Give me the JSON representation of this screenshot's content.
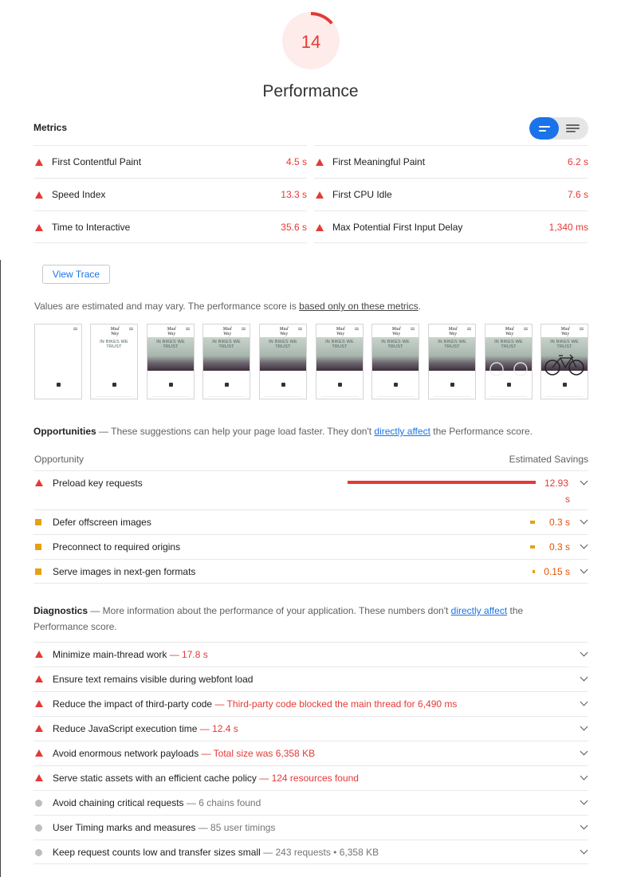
{
  "gauge": {
    "score": "14",
    "title": "Performance",
    "fraction": 0.14,
    "color": "#e53935"
  },
  "metrics": {
    "title": "Metrics",
    "items": [
      {
        "label": "First Contentful Paint",
        "value": "4.5 s"
      },
      {
        "label": "First Meaningful Paint",
        "value": "6.2 s"
      },
      {
        "label": "Speed Index",
        "value": "13.3 s"
      },
      {
        "label": "First CPU Idle",
        "value": "7.6 s"
      },
      {
        "label": "Time to Interactive",
        "value": "35.6 s"
      },
      {
        "label": "Max Potential First Input Delay",
        "value": "1,340 ms"
      }
    ]
  },
  "view_trace": "View Trace",
  "disclaimer": {
    "text": "Values are estimated and may vary. The performance score is ",
    "link": "based only on these metrics",
    "end": "."
  },
  "filmstrip": {
    "hero_text": "IN BIKES WE TRUST",
    "logo_text": "Mad Way"
  },
  "opportunities": {
    "title": "Opportunities",
    "desc": " — These suggestions can help your page load faster. They don't ",
    "link": "directly affect",
    "desc_end": " the Performance score.",
    "col_left": "Opportunity",
    "col_right": "Estimated Savings",
    "items": [
      {
        "label": "Preload key requests",
        "saving_line1": "12.93",
        "saving_line2": "s",
        "level": "fail",
        "bar_fraction": 1.0
      },
      {
        "label": "Defer offscreen images",
        "saving": "0.3 s",
        "level": "average",
        "bar_fraction": 0.02
      },
      {
        "label": "Preconnect to required origins",
        "saving": "0.3 s",
        "level": "average",
        "bar_fraction": 0.02
      },
      {
        "label": "Serve images in next-gen formats",
        "saving": "0.15 s",
        "level": "average",
        "bar_fraction": 0.01
      }
    ]
  },
  "diagnostics": {
    "title": "Diagnostics",
    "desc": " — More information about the performance of your application. These numbers don't ",
    "link": "directly affect",
    "desc_end": " the",
    "desc_line2": "Performance score.",
    "items": [
      {
        "label": "Minimize main-thread work",
        "detail": " — 17.8 s",
        "level": "fail"
      },
      {
        "label": "Ensure text remains visible during webfont load",
        "detail": "",
        "level": "fail"
      },
      {
        "label": "Reduce the impact of third-party code",
        "detail": " — Third-party code blocked the main thread for 6,490 ms",
        "level": "fail"
      },
      {
        "label": "Reduce JavaScript execution time",
        "detail": " — 12.4 s",
        "level": "fail"
      },
      {
        "label": "Avoid enormous network payloads",
        "detail": " — Total size was 6,358 KB",
        "level": "fail"
      },
      {
        "label": "Serve static assets with an efficient cache policy",
        "detail": " — 124 resources found",
        "level": "fail"
      },
      {
        "label": "Avoid chaining critical requests",
        "detail": " — 6 chains found",
        "level": "info"
      },
      {
        "label": "User Timing marks and measures",
        "detail": " — 85 user timings",
        "level": "info"
      },
      {
        "label": "Keep request counts low and transfer sizes small",
        "detail": " — 243 requests • 6,358 KB",
        "level": "info"
      }
    ]
  }
}
